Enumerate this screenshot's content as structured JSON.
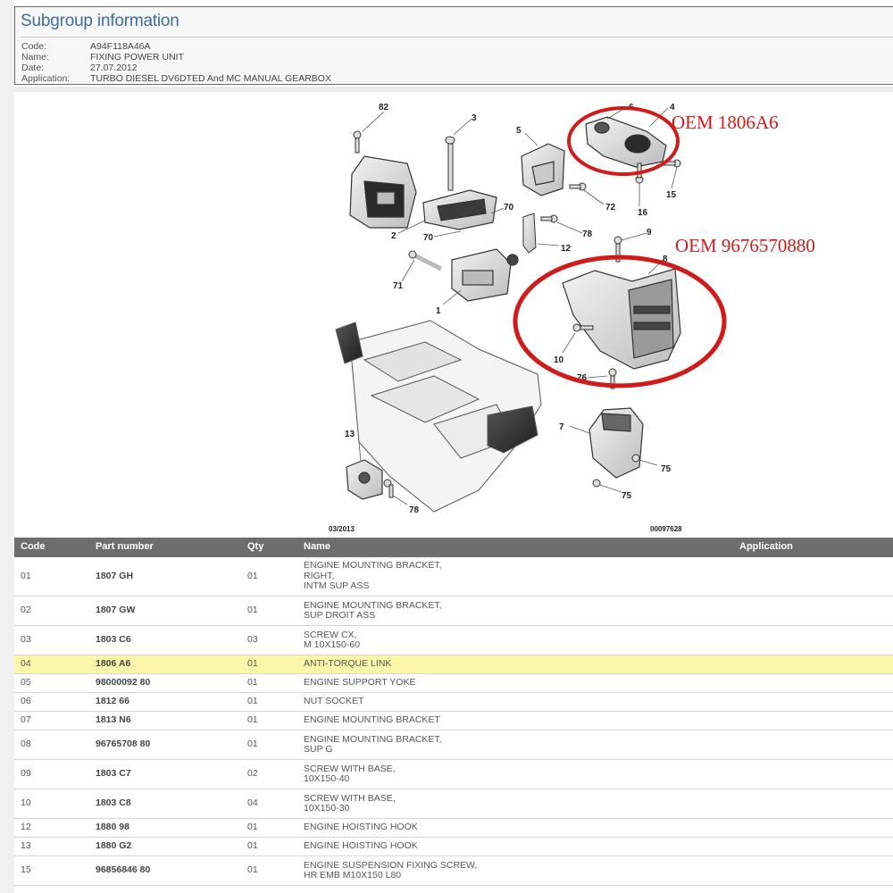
{
  "header": {
    "title": "Subgroup information",
    "rows": [
      {
        "key": "Code:",
        "value": "A94F118A46A"
      },
      {
        "key": "Name:",
        "value": "FIXING POWER UNIT"
      },
      {
        "key": "Date:",
        "value": "27.07.2012"
      },
      {
        "key": "Application:",
        "value": "TURBO DIESEL DV6DTED And MC MANUAL GEARBOX"
      }
    ]
  },
  "diagram": {
    "date_stamp": "03/2013",
    "ref_number": "00097628",
    "annotations": [
      "OEM 1806A6",
      "OEM 9676570880"
    ],
    "callouts": [
      "82",
      "3",
      "6",
      "4",
      "5",
      "72",
      "16",
      "15",
      "70",
      "2",
      "70",
      "78",
      "12",
      "9",
      "8",
      "71",
      "1",
      "10",
      "76",
      "7",
      "75",
      "75",
      "13",
      "78"
    ],
    "highlight_color": "#d11a1a"
  },
  "table": {
    "headers": [
      "Code",
      "Part number",
      "Qty",
      "Name",
      "Application"
    ],
    "rows": [
      {
        "code": "01",
        "part": "1807 GH",
        "qty": "01",
        "name": "ENGINE MOUNTING BRACKET,\nRIGHT,\nINTM SUP ASS",
        "app": ""
      },
      {
        "code": "02",
        "part": "1807 GW",
        "qty": "01",
        "name": "ENGINE MOUNTING BRACKET,\nSUP DROIT ASS",
        "app": ""
      },
      {
        "code": "03",
        "part": "1803 C6",
        "qty": "03",
        "name": "SCREW CX,\nM 10X150-60",
        "app": ""
      },
      {
        "code": "04",
        "part": "1806 A6",
        "qty": "01",
        "name": "ANTI-TORQUE LINK",
        "app": ""
      },
      {
        "code": "05",
        "part": "98000092 80",
        "qty": "01",
        "name": "ENGINE SUPPORT YOKE",
        "app": ""
      },
      {
        "code": "06",
        "part": "1812 66",
        "qty": "01",
        "name": "NUT SOCKET",
        "app": ""
      },
      {
        "code": "07",
        "part": "1813 N6",
        "qty": "01",
        "name": "ENGINE MOUNTING BRACKET",
        "app": ""
      },
      {
        "code": "08",
        "part": "96765708 80",
        "qty": "01",
        "name": "ENGINE MOUNTING BRACKET,\nSUP G",
        "app": ""
      },
      {
        "code": "09",
        "part": "1803 C7",
        "qty": "02",
        "name": "SCREW WITH BASE,\n10X150-40",
        "app": ""
      },
      {
        "code": "10",
        "part": "1803 C8",
        "qty": "04",
        "name": "SCREW WITH BASE,\n10X150-30",
        "app": ""
      },
      {
        "code": "12",
        "part": "1880 98",
        "qty": "01",
        "name": "ENGINE HOISTING HOOK",
        "app": ""
      },
      {
        "code": "13",
        "part": "1880 G2",
        "qty": "01",
        "name": "ENGINE HOISTING HOOK",
        "app": ""
      },
      {
        "code": "15",
        "part": "96856846 80",
        "qty": "01",
        "name": "ENGINE SUSPENSION FIXING SCREW,\nHR EMB M10X150 L80",
        "app": ""
      }
    ],
    "highlight_color": "#fbf6a9"
  }
}
